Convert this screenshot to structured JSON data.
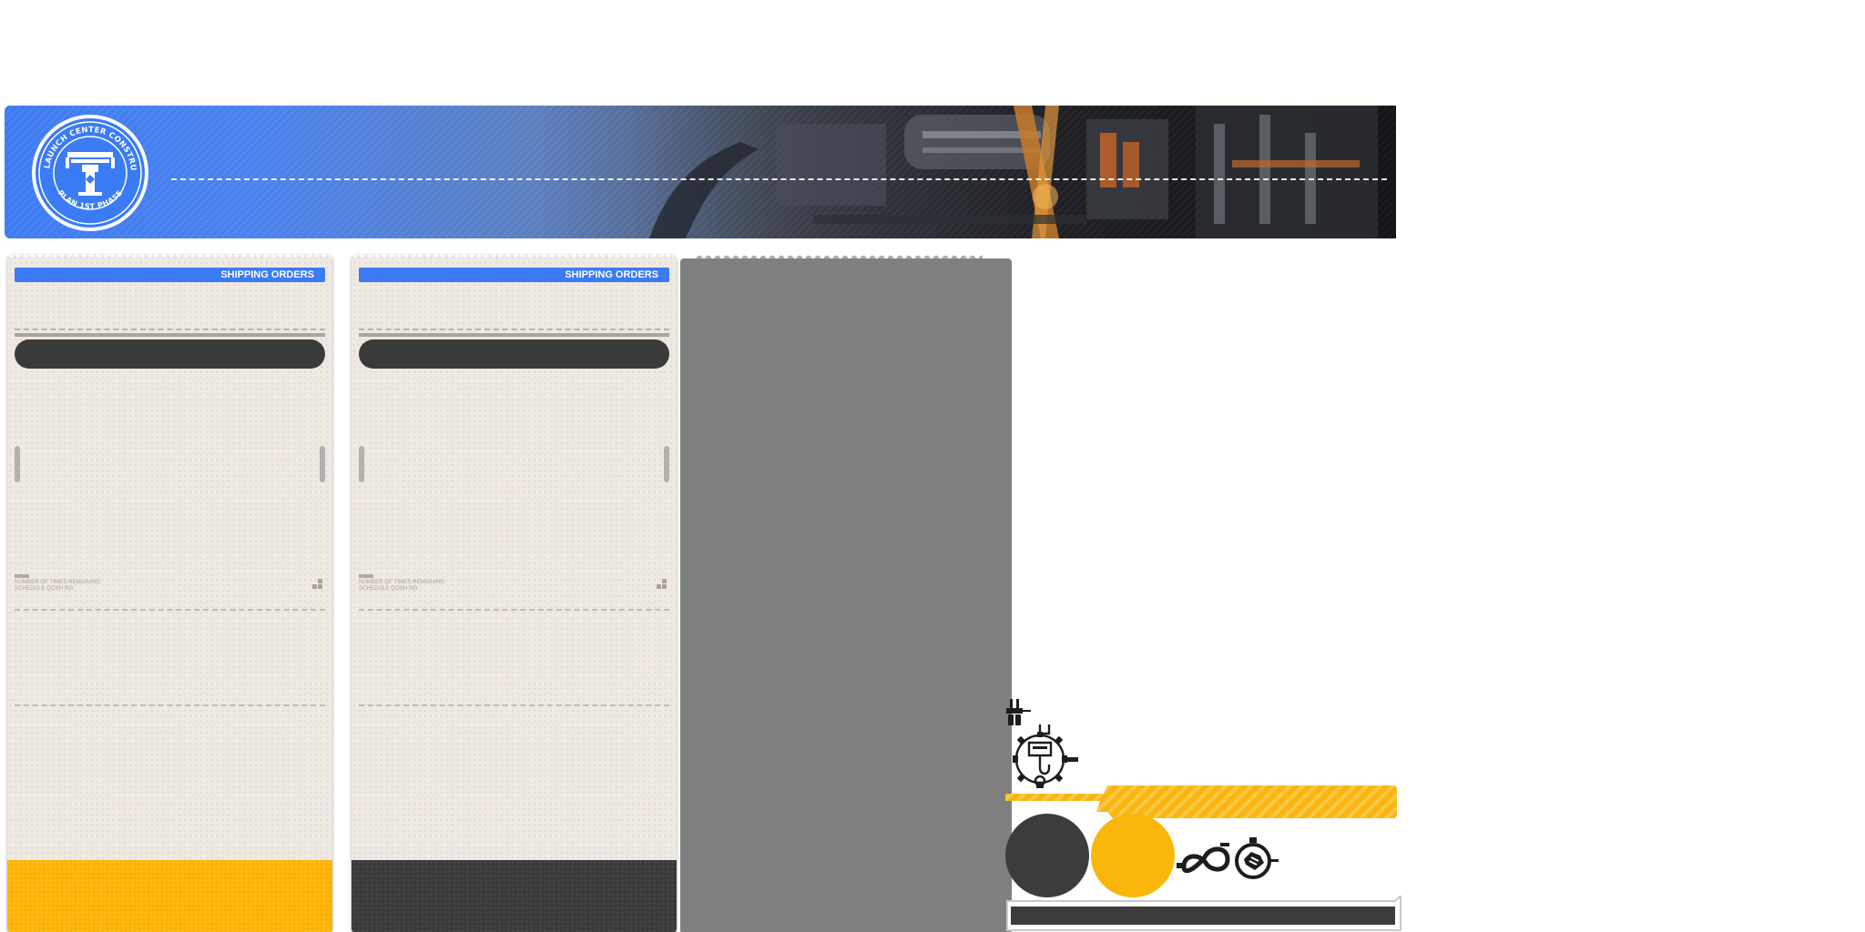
{
  "banner": {
    "logo": {
      "ring_text_top": "ANITA LAUNCH CENTER CONSTRUCTION",
      "ring_text_bottom": "PLAN 1ST PHASE"
    }
  },
  "cards": [
    {
      "header_label": "SHIPPING ORDERS",
      "meta_line1": "NUMBER OF TIMES REMAINING",
      "meta_line2": "SCHEDULE  QOSH  RG.",
      "footer_color": "#fbb202"
    },
    {
      "header_label": "SHIPPING ORDERS",
      "meta_line1": "NUMBER OF TIMES REMAINING",
      "meta_line2": "SCHEDULE  QOSH  RG.",
      "footer_color": "#3a3a3a"
    }
  ],
  "colors": {
    "accent_blue": "#3b7bf4",
    "accent_yellow": "#fbb60e",
    "dark": "#3a3a3a",
    "paper": "#eee9e2",
    "placeholder_grey": "#808080"
  },
  "icons": {
    "logo": "anita-launch-center-logo-icon",
    "qr": "qr-code-icon",
    "tool": "gripper-tool-icon",
    "crane": "crane-hook-gear-icon",
    "loop": "infinity-loop-icon",
    "handshake": "handshake-icon"
  }
}
